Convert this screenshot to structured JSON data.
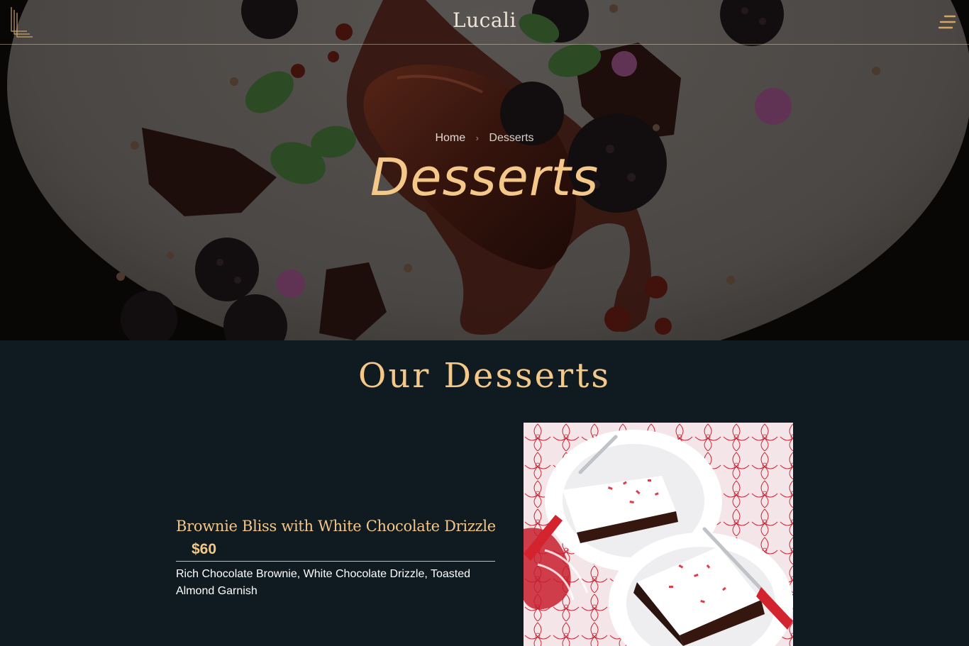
{
  "header": {
    "brand": "Lucali",
    "logo_icon": "lucali-monogram-icon",
    "menu_icon": "hamburger-menu-icon"
  },
  "hero": {
    "breadcrumb": [
      {
        "label": "Home"
      },
      {
        "label": "Desserts"
      }
    ],
    "title": "Desserts"
  },
  "section": {
    "title": "Our Desserts"
  },
  "menu_items": [
    {
      "name": "Brownie Bliss with White Chocolate Drizzle",
      "price": "$60",
      "description": "Rich Chocolate Brownie, White Chocolate Drizzle, Toasted Almond Garnish",
      "image": "peppermint-brownie-photo"
    }
  ],
  "colors": {
    "accent_gold": "#f4c889",
    "section_bg": "#0f1b21",
    "text_light": "#ffffff"
  }
}
